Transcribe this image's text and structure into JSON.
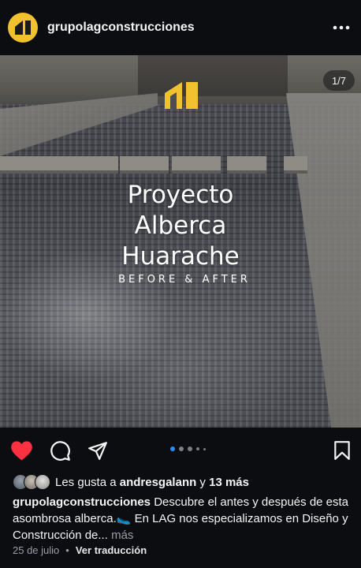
{
  "header": {
    "username": "grupolagconstrucciones",
    "more_icon": "more-horizontal-icon"
  },
  "media": {
    "counter": "1/7",
    "overlay_title_lines": [
      "Proyecto",
      "Alberca",
      "Huarache"
    ],
    "overlay_subtitle": "BEFORE & AFTER",
    "brand_color": "#f2c12e",
    "carousel_dots": 5,
    "active_dot": 0
  },
  "actions": {
    "like_icon": "heart-filled-icon",
    "comment_icon": "comment-icon",
    "share_icon": "send-icon",
    "save_icon": "bookmark-icon",
    "like_color": "#ff3040"
  },
  "likes": {
    "prefix": "Les gusta a ",
    "user": "andresgalann",
    "connector": " y ",
    "others": "13 más"
  },
  "caption": {
    "username": "grupolagconstrucciones",
    "text": " Descubre el antes y después de esta asombrosa alberca.",
    "emoji": "🥿",
    "text2": " En LAG nos especializamos en Diseño y Construcción de...",
    "more": " más"
  },
  "meta": {
    "date": "25 de julio",
    "separator": "•",
    "translate": "Ver traducción"
  }
}
